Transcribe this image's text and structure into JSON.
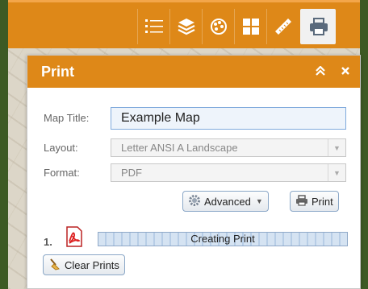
{
  "toolbar": {
    "tools": [
      {
        "name": "legend-icon"
      },
      {
        "name": "layers-icon"
      },
      {
        "name": "basemap-palette-icon"
      },
      {
        "name": "basemap-gallery-icon"
      },
      {
        "name": "measure-ruler-icon"
      },
      {
        "name": "print-icon",
        "active": true
      }
    ]
  },
  "panel": {
    "title": "Print",
    "collapse_icon": "double-chevron-up-icon",
    "close_icon": "close-icon",
    "map_title_label": "Map Title:",
    "map_title_value": "Example Map",
    "layout_label": "Layout:",
    "layout_value": "Letter ANSI A Landscape",
    "format_label": "Format:",
    "format_value": "PDF",
    "advanced_label": "Advanced",
    "print_label": "Print",
    "jobs": [
      {
        "number": "1.",
        "status": "Creating Print",
        "file_type": "pdf-icon"
      }
    ],
    "clear_label": "Clear Prints"
  },
  "colors": {
    "accent": "#de8818",
    "frame": "#3d5a24",
    "input_border": "#7fa9dc"
  }
}
